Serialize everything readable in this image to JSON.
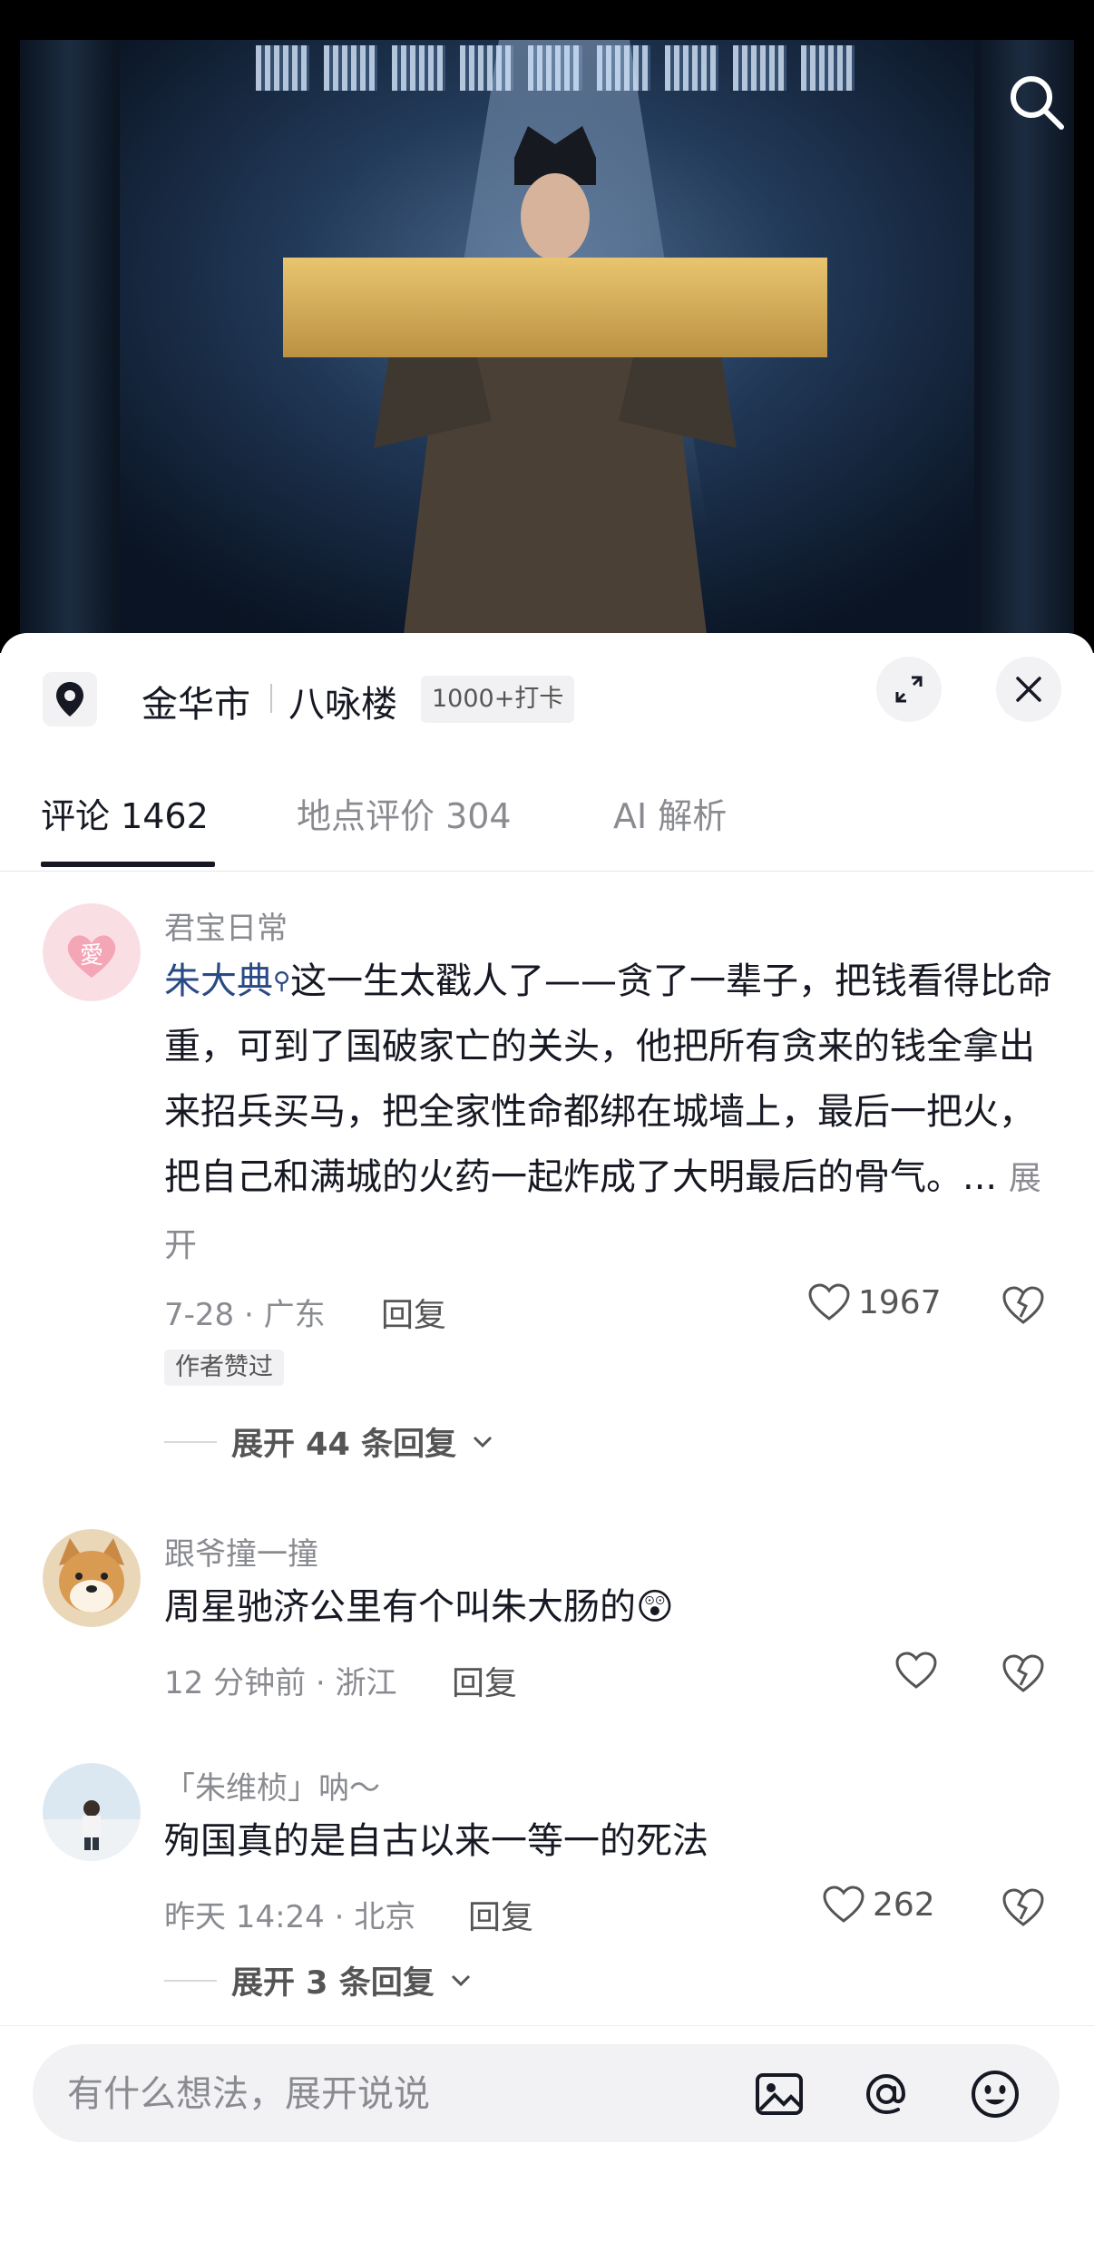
{
  "location": {
    "city": "金华市",
    "place": "八咏楼",
    "checkin_badge": "1000+打卡"
  },
  "tabs": [
    {
      "label": "评论 1462"
    },
    {
      "label": "地点评价 304"
    },
    {
      "label": "AI 解析"
    }
  ],
  "comments": [
    {
      "user": "君宝日常",
      "mention": "朱大典",
      "text": "这一生太戳人了——贪了一辈子，把钱看得比命重，可到了国破家亡的关头，他把所有贪来的钱全拿出来招兵买马，把全家性命都绑在城墙上，最后一把火，把自己和满城的火药一起炸成了大明最后的骨气。...",
      "more": "展开",
      "meta": "7-28 · 广东",
      "reply": "回复",
      "likes": "1967",
      "author_tag": "作者赞过",
      "expand": "展开 44 条回复"
    },
    {
      "user": "跟爷撞一撞",
      "text": "周星驰济公里有个叫朱大肠的",
      "meta": "12 分钟前 · 浙江",
      "reply": "回复",
      "likes": ""
    },
    {
      "user": "「朱维桢」呐～",
      "text": "殉国真的是自古以来一等一的死法",
      "meta": "昨天 14:24 · 北京",
      "reply": "回复",
      "likes": "262",
      "expand": "展开 3 条回复"
    }
  ],
  "input": {
    "placeholder": "有什么想法，展开说说"
  },
  "icons": {
    "video_search": "search-icon",
    "location": "location-pin-icon",
    "collapse": "shrink-icon",
    "close": "close-icon",
    "like": "heart-icon",
    "dislike": "broken-heart-icon",
    "image": "image-icon",
    "mention": "at-icon",
    "emoji": "emoji-icon"
  },
  "colors": {
    "mention": "#2a4a85",
    "text": "#161823",
    "muted": "#8a8b91"
  }
}
